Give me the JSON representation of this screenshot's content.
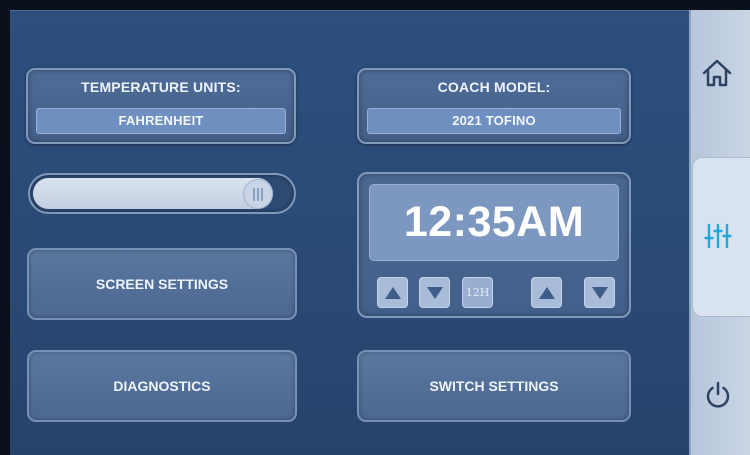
{
  "settings": {
    "temperature_units": {
      "title": "TEMPERATURE UNITS:",
      "value": "FAHRENHEIT"
    },
    "coach_model": {
      "title": "COACH MODEL:",
      "value": "2021 TOFINO"
    }
  },
  "brightness_slider": {
    "level_fraction": 0.92
  },
  "clock": {
    "time": "12:35AM",
    "mode_label": "12H"
  },
  "buttons": {
    "screen_settings": "SCREEN SETTINGS",
    "diagnostics": "DIAGNOSTICS",
    "switch_settings": "SWITCH SETTINGS"
  },
  "sidebar": {
    "items": [
      {
        "icon": "home-icon",
        "active": false
      },
      {
        "icon": "sliders-icon",
        "active": true
      },
      {
        "icon": "power-icon",
        "active": false
      }
    ]
  },
  "colors": {
    "background": "#2a4a76",
    "accent_active_icon": "#1fa9d6",
    "sidebar": "#c9d5e5"
  }
}
